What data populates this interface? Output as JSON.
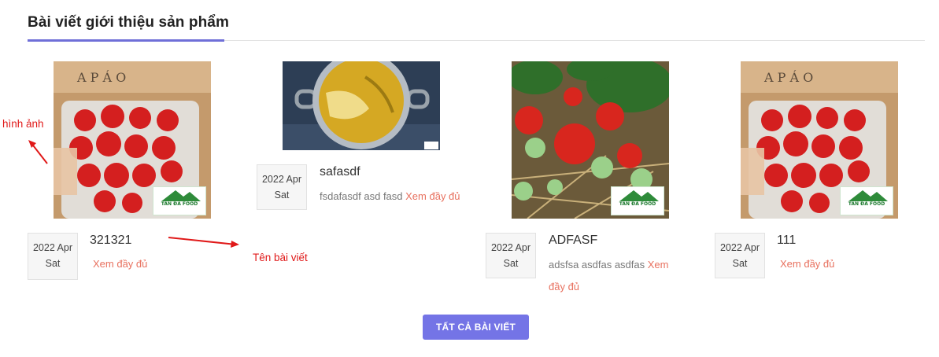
{
  "section": {
    "title": "Bài viết giới thiệu sản phẩm"
  },
  "posts": [
    {
      "title": "321321",
      "date_line1": "2022 Apr",
      "date_line2": "Sat",
      "description": "",
      "read_more": "Xem đầy đủ",
      "image": "strawberry-box-photo",
      "logo_text": "TÂN ĐÀ FOOD"
    },
    {
      "title": "safasdf",
      "date_line1": "2022 Apr",
      "date_line2": "Sat",
      "description": "fsdafasdf asd fasd",
      "read_more": "Xem đầy đủ",
      "image": "cooking-pot-photo"
    },
    {
      "title": "ADFASF",
      "date_line1": "2022 Apr",
      "date_line2": "Sat",
      "description": "adsfsa asdfas asdfas",
      "read_more": "Xem đầy đủ",
      "image": "strawberry-plant-photo",
      "logo_text": "TÂN ĐÀ FOOD"
    },
    {
      "title": "111",
      "date_line1": "2022 Apr",
      "date_line2": "Sat",
      "description": "",
      "read_more": "Xem đầy đủ",
      "image": "strawberry-box-photo",
      "logo_text": "TÂN ĐÀ FOOD"
    }
  ],
  "annotations": {
    "image_label": "hình ảnh",
    "title_label": "Tên bài viết"
  },
  "all_posts_button": "TẤT CẢ BÀI VIẾT",
  "colors": {
    "accent": "#7474e6",
    "read_more": "#e8715f",
    "annotation": "#e01919"
  }
}
